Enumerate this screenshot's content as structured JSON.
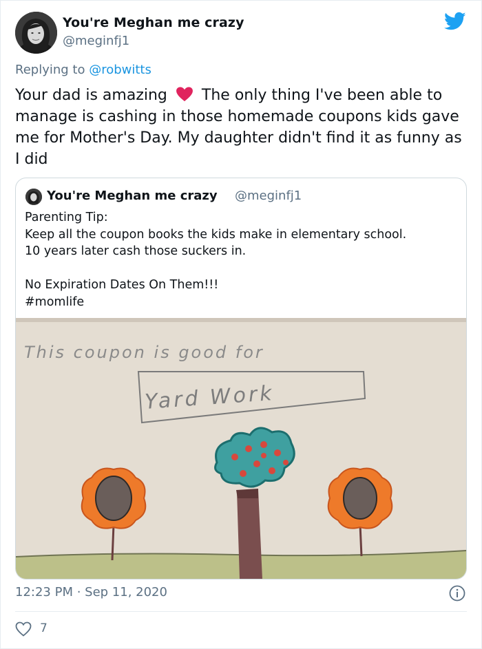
{
  "tweet": {
    "display_name": "You're Meghan me crazy",
    "handle": "@meginfj1",
    "replying_prefix": "Replying to ",
    "replying_to": "@robwitts",
    "text_before_emoji": "Your dad is amazing",
    "emoji": "red-heart",
    "text_after_emoji": "The only thing I've been able to manage is cashing in those homemade coupons kids gave me for Mother's Day. My daughter didn't find it as funny as I did",
    "timestamp": "12:23 PM · Sep 11, 2020",
    "like_count": "7"
  },
  "quoted": {
    "display_name": "You're Meghan me crazy",
    "handle": "@meginfj1",
    "text": "Parenting Tip:\nKeep all the coupon books the kids make in elementary school.\n10 years later cash those suckers in.\n\nNo Expiration Dates On Them!!!\n#momlife",
    "photo": {
      "line1": "This coupon is good for",
      "line2": "Yard Work"
    }
  },
  "colors": {
    "brand_blue": "#1da1f2",
    "secondary_text": "#5b7083",
    "heart_red": "#e0245e"
  },
  "icons": {
    "platform": "twitter-bird-icon",
    "info": "info-icon",
    "like": "heart-outline-icon"
  }
}
